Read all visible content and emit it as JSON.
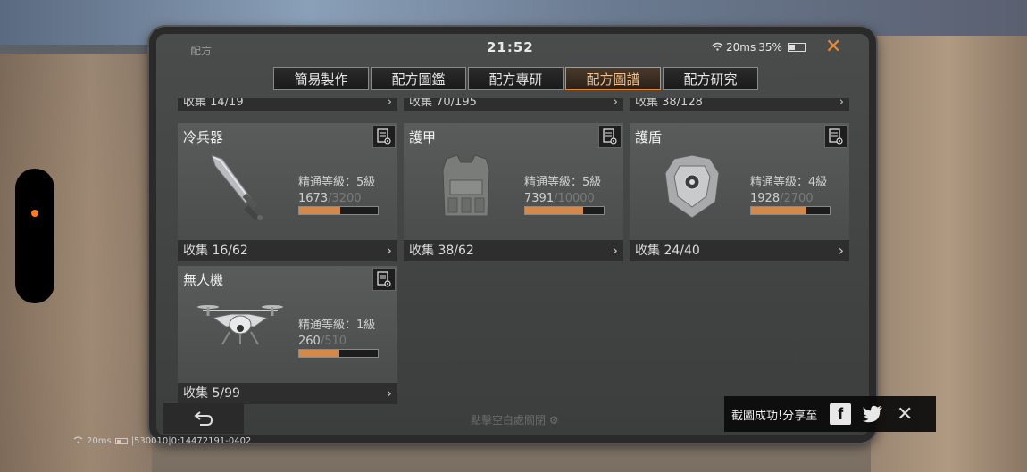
{
  "status": {
    "app_name": "配方",
    "time": "21:52",
    "ping": "20ms",
    "battery_pct": "35%"
  },
  "tabs": [
    {
      "label": "簡易製作",
      "active": false
    },
    {
      "label": "配方圖鑑",
      "active": false
    },
    {
      "label": "配方專研",
      "active": false
    },
    {
      "label": "配方圖譜",
      "active": true
    },
    {
      "label": "配方研究",
      "active": false
    }
  ],
  "partial_row": [
    {
      "label": "收集 14/19"
    },
    {
      "label": "收集 70/195"
    },
    {
      "label": "收集 38/128"
    }
  ],
  "cards": [
    {
      "title": "冷兵器",
      "level": "精通等級：5級",
      "current": "1673",
      "max": "/3200",
      "progress": 0.52,
      "footer": "收集 16/62",
      "icon": "sword-icon"
    },
    {
      "title": "護甲",
      "level": "精通等級：5級",
      "current": "7391",
      "max": "/10000",
      "progress": 0.74,
      "footer": "收集 38/62",
      "icon": "armor-vest-icon"
    },
    {
      "title": "護盾",
      "level": "精通等級：4級",
      "current": "1928",
      "max": "/2700",
      "progress": 0.71,
      "footer": "收集 24/40",
      "icon": "shield-armor-icon"
    },
    {
      "title": "無人機",
      "level": "精通等級：1級",
      "current": "260",
      "max": "/510",
      "progress": 0.51,
      "footer": "收集 5/99",
      "icon": "drone-icon"
    }
  ],
  "hint": "點擊空白處關閉",
  "share": {
    "text": "截圖成功!分享至"
  },
  "overlay": {
    "ping": "20ms",
    "id_text": "|530010|0:14472191-0402"
  },
  "colors": {
    "accent": "#e8893a",
    "progress": "#d4884a"
  }
}
